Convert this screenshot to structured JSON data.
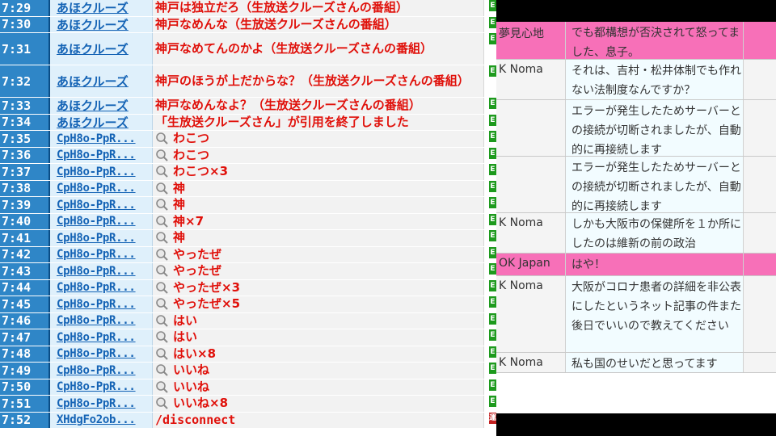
{
  "comment_log": [
    {
      "time": "7:29",
      "user": "あほクルーズ",
      "message": "神戸は独立だろ（生放送クルーズさんの番組）",
      "mag": false
    },
    {
      "time": "7:30",
      "user": "あほクルーズ",
      "message": "神戸なめんな（生放送クルーズさんの番組）",
      "mag": false
    },
    {
      "time": "7:31",
      "user": "あほクルーズ",
      "message": "神戸なめてんのかよ（生放送クルーズさんの番組）",
      "mag": false
    },
    {
      "time": "7:32",
      "user": "あほクルーズ",
      "message": "神戸のほうが上だからな？（生放送クルーズさんの番組）",
      "mag": false
    },
    {
      "time": "7:33",
      "user": "あほクルーズ",
      "message": "神戸なめんなよ？（生放送クルーズさんの番組）",
      "mag": false
    },
    {
      "time": "7:34",
      "user": "あほクルーズ",
      "message": "「生放送クルーズさん」が引用を終了しました",
      "mag": false
    },
    {
      "time": "7:35",
      "user": "CpH8o-PpR...",
      "message": "わこつ",
      "mag": true
    },
    {
      "time": "7:36",
      "user": "CpH8o-PpR...",
      "message": "わこつ",
      "mag": true
    },
    {
      "time": "7:37",
      "user": "CpH8o-PpR...",
      "message": "わこつ×3",
      "mag": true
    },
    {
      "time": "7:38",
      "user": "CpH8o-PpR...",
      "message": "神",
      "mag": true
    },
    {
      "time": "7:39",
      "user": "CpH8o-PpR...",
      "message": "神",
      "mag": true
    },
    {
      "time": "7:40",
      "user": "CpH8o-PpR...",
      "message": "神×7",
      "mag": true
    },
    {
      "time": "7:41",
      "user": "CpH8o-PpR...",
      "message": "神",
      "mag": true
    },
    {
      "time": "7:42",
      "user": "CpH8o-PpR...",
      "message": "やったぜ",
      "mag": true
    },
    {
      "time": "7:43",
      "user": "CpH8o-PpR...",
      "message": "やったぜ",
      "mag": true
    },
    {
      "time": "7:44",
      "user": "CpH8o-PpR...",
      "message": "やったぜ×3",
      "mag": true
    },
    {
      "time": "7:45",
      "user": "CpH8o-PpR...",
      "message": "やったぜ×5",
      "mag": true
    },
    {
      "time": "7:46",
      "user": "CpH8o-PpR...",
      "message": "はい",
      "mag": true
    },
    {
      "time": "7:47",
      "user": "CpH8o-PpR...",
      "message": "はい",
      "mag": true
    },
    {
      "time": "7:48",
      "user": "CpH8o-PpR...",
      "message": "はい×8",
      "mag": true
    },
    {
      "time": "7:49",
      "user": "CpH8o-PpR...",
      "message": "いいね",
      "mag": true
    },
    {
      "time": "7:50",
      "user": "CpH8o-PpR...",
      "message": "いいね",
      "mag": true
    },
    {
      "time": "7:51",
      "user": "CpH8o-PpR...",
      "message": "いいね×8",
      "mag": true
    },
    {
      "time": "7:52",
      "user": "XHdgFo2ob...",
      "message": "/disconnect",
      "mag": false
    }
  ],
  "flag_glyphs": {
    "normal": "E",
    "last": "運"
  },
  "colors": {
    "time_bg": "#2f86c7",
    "user_link": "#1463b5",
    "message_red": "#e0100a",
    "flag_green": "#1d9a1d",
    "pink_highlight": "#f770b8"
  },
  "chat": [
    {
      "name": "夢見心地",
      "message": "でも都構想が否決されて怒ってました、息子。",
      "highlight": true
    },
    {
      "name": "K Noma",
      "message": "それは、吉村・松井体制でも作れない法制度なんですか？",
      "highlight": false
    },
    {
      "name": "",
      "message": "エラーが発生したためサーバーとの接続が切断されましたが、自動的に再接続します",
      "highlight": false
    },
    {
      "name": "",
      "message": "エラーが発生したためサーバーとの接続が切断されましたが、自動的に再接続します",
      "highlight": false
    },
    {
      "name": "K Noma",
      "message": "しかも大阪市の保健所を１か所にしたのは維新の前の政治",
      "highlight": false
    },
    {
      "name": "OK Japan",
      "message": "はや！",
      "highlight": true
    },
    {
      "name": "K Noma",
      "message": "大阪がコロナ患者の詳細を非公表にしたというネット記事の件また後日でいいので教えてください",
      "highlight": false
    },
    {
      "name": "K Noma",
      "message": "私も国のせいだと思ってます",
      "highlight": false
    }
  ]
}
